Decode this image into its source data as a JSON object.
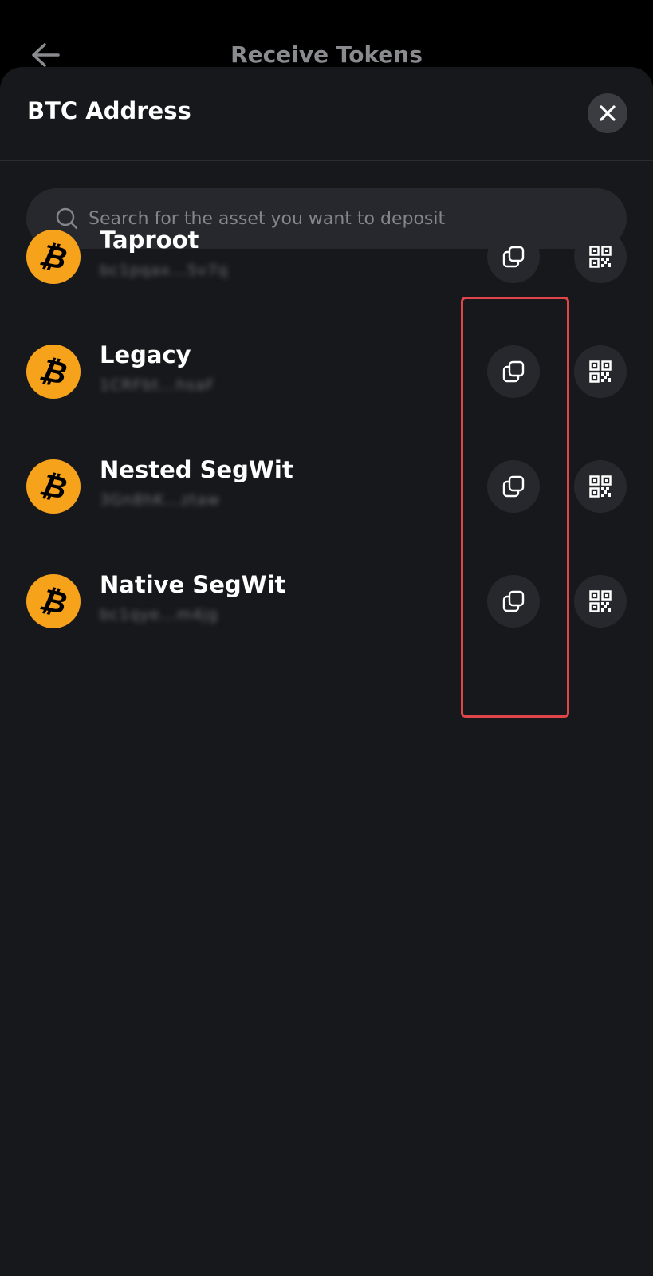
{
  "header": {
    "title": "Receive Tokens",
    "back_icon": "arrow-left-icon"
  },
  "sheet": {
    "title": "BTC Address",
    "close_icon": "close-icon",
    "search": {
      "placeholder": "Search for the asset you want to deposit",
      "value": ""
    }
  },
  "addresses": [
    {
      "name": "Taproot",
      "address": "bc1pqax...5v7q",
      "coin_symbol": "₿"
    },
    {
      "name": "Legacy",
      "address": "1CRFbt...hsaF",
      "coin_symbol": "₿"
    },
    {
      "name": "Nested SegWit",
      "address": "3Gn8hK...ztaw",
      "coin_symbol": "₿"
    },
    {
      "name": "Native SegWit",
      "address": "bc1qye...m4jg",
      "coin_symbol": "₿"
    }
  ],
  "colors": {
    "accent": "#f7a21b",
    "highlight": "#e0454a",
    "sheet_bg": "#17181c",
    "button_bg": "#27282d"
  }
}
